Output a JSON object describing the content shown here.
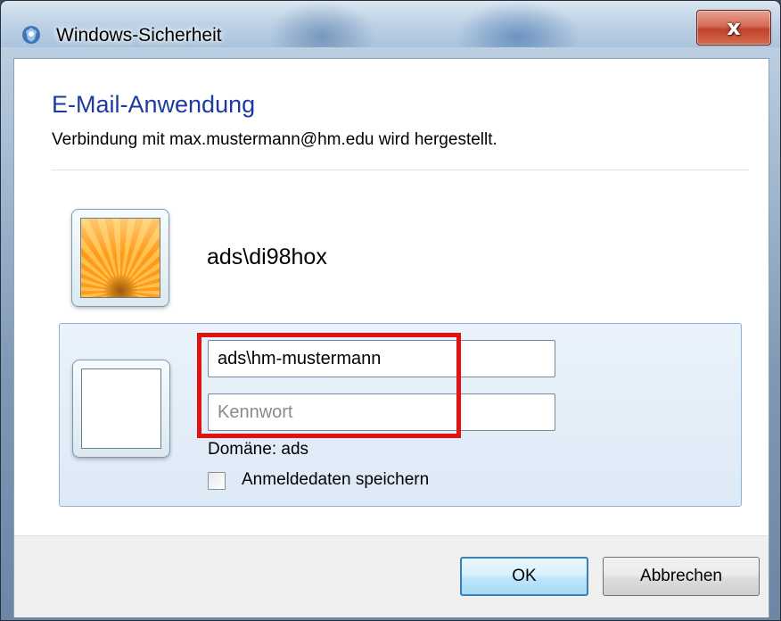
{
  "window": {
    "title": "Windows-Sicherheit",
    "close_label": "x"
  },
  "header": {
    "title": "E-Mail-Anwendung",
    "subtitle": "Verbindung mit max.mustermann@hm.edu wird hergestellt."
  },
  "saved_account": {
    "name": "ads\\di98hox",
    "icon": "flower-user-tile-icon"
  },
  "credentials": {
    "username_value": "ads\\hm-mustermann",
    "password_placeholder": "Kennwort",
    "domain_text": "Domäne: ads",
    "remember_label": "Anmeldedaten speichern",
    "remember_checked": false,
    "icon": "blank-user-tile-icon"
  },
  "buttons": {
    "ok": "OK",
    "cancel": "Abbrechen"
  },
  "colors": {
    "title_blue": "#1e3aa0",
    "highlight_red": "#e11212",
    "panel_border": "#8ab4d8",
    "close_red": "#c1412a"
  }
}
